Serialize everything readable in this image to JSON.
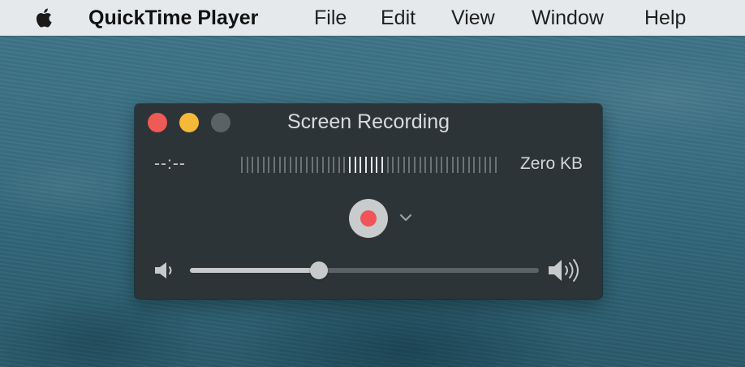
{
  "menubar": {
    "apple_icon": "apple-logo-icon",
    "app_name": "QuickTime Player",
    "items": [
      "File",
      "Edit",
      "View",
      "Window",
      "Help"
    ]
  },
  "window": {
    "title": "Screen Recording",
    "time": "--:--",
    "file_size": "Zero KB",
    "audio_level_meter": {
      "bar_count": 48,
      "active_bars": [
        20,
        21,
        22,
        23,
        24,
        25,
        26
      ]
    },
    "record_button_icon": "record-icon",
    "options_icon": "chevron-down-icon",
    "volume": {
      "low_icon": "speaker-low-icon",
      "high_icon": "speaker-high-icon",
      "level": 0.37
    }
  },
  "colors": {
    "menubar_bg": "#e6e9ec",
    "window_bg": "#2c3437",
    "close": "#ee5a55",
    "minimize": "#f4b938",
    "zoom_disabled": "#5b6266",
    "record_dot": "#f0535a"
  }
}
